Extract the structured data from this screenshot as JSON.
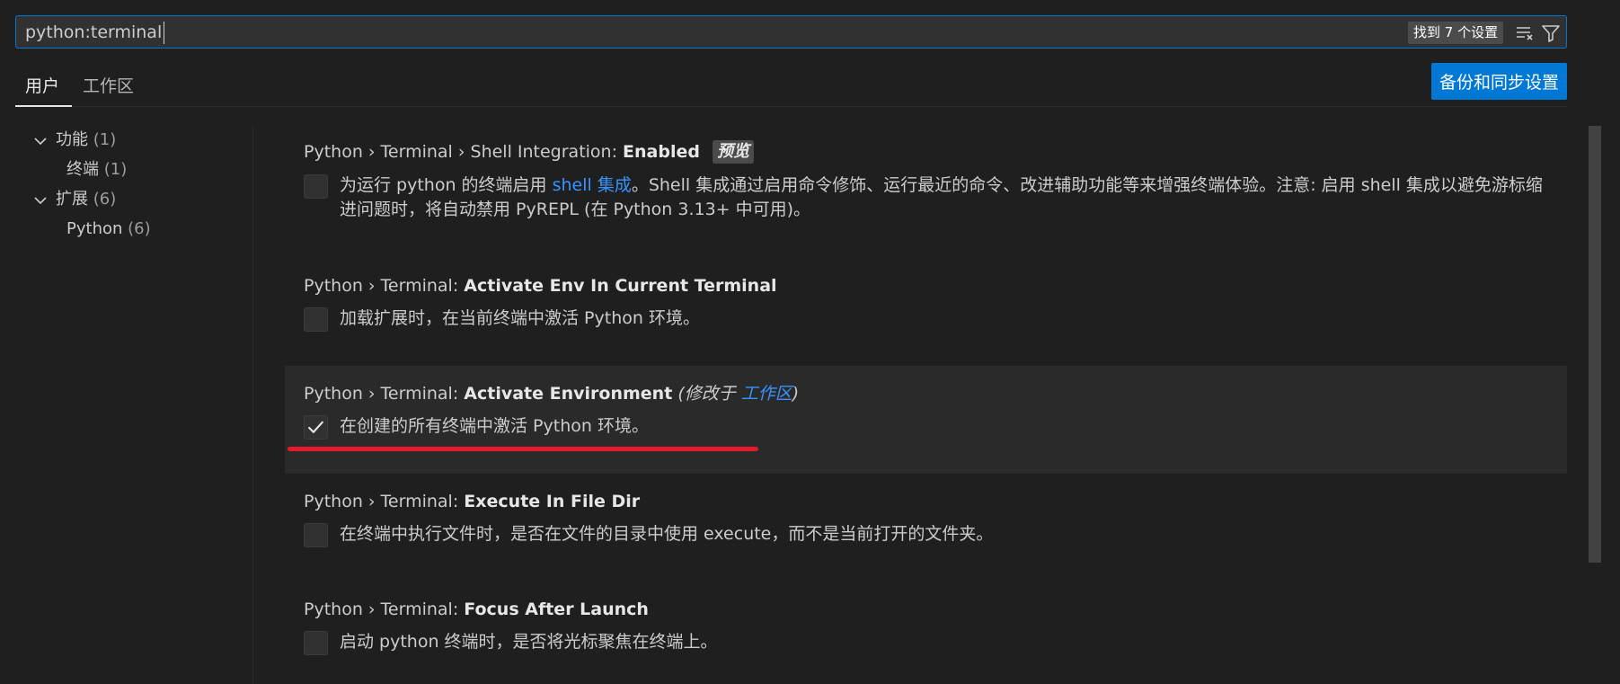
{
  "search": {
    "value": "python:terminal",
    "result_count": "找到 7 个设置",
    "clear_filter_icon": "clear-filter-icon",
    "filter_icon": "filter-icon"
  },
  "tabs": [
    {
      "label": "用户",
      "active": true
    },
    {
      "label": "工作区",
      "active": false
    }
  ],
  "sync_button_label": "备份和同步设置",
  "toc": [
    {
      "label": "功能",
      "count": "(1)",
      "expanded": true,
      "level": 0
    },
    {
      "label": "终端",
      "count": "(1)",
      "level": 1
    },
    {
      "label": "扩展",
      "count": "(6)",
      "expanded": true,
      "level": 0
    },
    {
      "label": "Python",
      "count": "(6)",
      "level": 1
    }
  ],
  "settings": [
    {
      "category": "Python › Terminal › Shell Integration: ",
      "name": "Enabled",
      "badge": "预览",
      "checked": false,
      "desc_part1": "为运行 python 的终端启用 ",
      "desc_link": "shell 集成",
      "desc_part2": "。Shell 集成通过启用命令修饰、运行最近的命令、改进辅助功能等来增强终端体验。注意: 启用 shell 集成以避免游标缩",
      "desc_line2": "进问题时，将自动禁用 PyREPL (在 Python 3.13+ 中可用)。"
    },
    {
      "category": "Python › Terminal: ",
      "name": "Activate Env In Current Terminal",
      "checked": false,
      "desc": "加载扩展时，在当前终端中激活 Python 环境。"
    },
    {
      "category": "Python › Terminal: ",
      "name": "Activate Environment",
      "modified_prefix": "(修改于 ",
      "modified_link": "工作区",
      "modified_suffix": ")",
      "checked": true,
      "desc": "在创建的所有终端中激活 Python 环境。"
    },
    {
      "category": "Python › Terminal: ",
      "name": "Execute In File Dir",
      "checked": false,
      "desc": "在终端中执行文件时，是否在文件的目录中使用 execute，而不是当前打开的文件夹。"
    },
    {
      "category": "Python › Terminal: ",
      "name": "Focus After Launch",
      "checked": false,
      "desc": "启动 python 终端时，是否将光标聚焦在终端上。"
    }
  ],
  "colors": {
    "background": "#1f1f1f",
    "accent": "#0078d4",
    "link": "#3794ff",
    "annotation": "#e8192c"
  }
}
